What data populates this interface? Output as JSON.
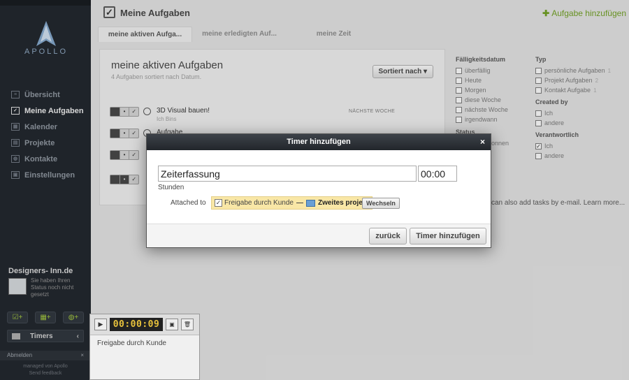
{
  "sidebar": {
    "logo_text": "APOLLO",
    "nav": [
      {
        "label": "Übersicht",
        "icon": "overview-icon"
      },
      {
        "label": "Meine Aufgaben",
        "icon": "checkbox-icon"
      },
      {
        "label": "Kalender",
        "icon": "calendar-icon"
      },
      {
        "label": "Projekte",
        "icon": "projects-icon"
      },
      {
        "label": "Kontakte",
        "icon": "contacts-icon"
      },
      {
        "label": "Einstellungen",
        "icon": "settings-icon"
      }
    ],
    "profile_name": "Designers- Inn.de",
    "profile_status": "Sie haben Ihren Status noch nicht gesetzt",
    "timers_label": "Timers",
    "logout_label": "Abmelden",
    "footer_line1": "managed von Apollo",
    "footer_line2": "Send feedback"
  },
  "header": {
    "title": "Meine Aufgaben",
    "add_task": "Aufgabe hinzufügen"
  },
  "tabs": [
    {
      "label": "meine aktiven Aufga..."
    },
    {
      "label": "meine erledigten Auf..."
    },
    {
      "label": "meine Zeit"
    }
  ],
  "panel": {
    "title": "meine aktiven Aufgaben",
    "subtitle": "4 Aufgaben sortiert nach Datum.",
    "sort_label": "Sortiert nach ▾",
    "tasks": [
      {
        "name": "3D Visual bauen!",
        "owner": "Ich Bins"
      },
      {
        "name": "Aufgabe",
        "owner": ""
      }
    ],
    "due_tag": "NÄCHSTE WOCHE"
  },
  "filters": {
    "due_heading": "Fälligkeitsdatum",
    "due_items": [
      "überfällig",
      "Heute",
      "Morgen",
      "diese Woche",
      "nächste Woche",
      "irgendwann"
    ],
    "status_heading": "Status",
    "status_partial": "gonnen",
    "type_heading": "Typ",
    "type_items": [
      {
        "label": "persönliche Aufgaben",
        "count": "1"
      },
      {
        "label": "Projekt Aufgaben",
        "count": "2"
      },
      {
        "label": "Kontakt Aufgabe",
        "count": "1"
      }
    ],
    "created_heading": "Created by",
    "created_items": [
      "Ich",
      "andere"
    ],
    "resp_heading": "Verantwortlich",
    "resp_items": [
      {
        "label": "Ich",
        "checked": true
      },
      {
        "label": "andere",
        "checked": false
      }
    ],
    "email_note": "can also add tasks by e-mail. Learn more..."
  },
  "timer_widget": {
    "display": "00:00:09",
    "label": "Freigabe durch Kunde"
  },
  "modal": {
    "title": "Timer hinzufügen",
    "close": "×",
    "name_value": "Zeiterfassung",
    "time_value": "00:00",
    "hours_label": "Stunden",
    "attached_label": "Attached to",
    "attached_task": "Freigabe durch Kunde",
    "attached_sep": "—",
    "attached_project": "Zweites projekt",
    "switch_label": "Wechseln",
    "back_label": "zurück",
    "submit_label": "Timer hinzufügen"
  },
  "colors": {
    "sidebar_bg": "#1f242b",
    "accent_green": "#6d9b22",
    "modal_header": "#2b2f35",
    "timer_digits": "#e8c23c",
    "attached_chip": "#f9e7a6"
  }
}
